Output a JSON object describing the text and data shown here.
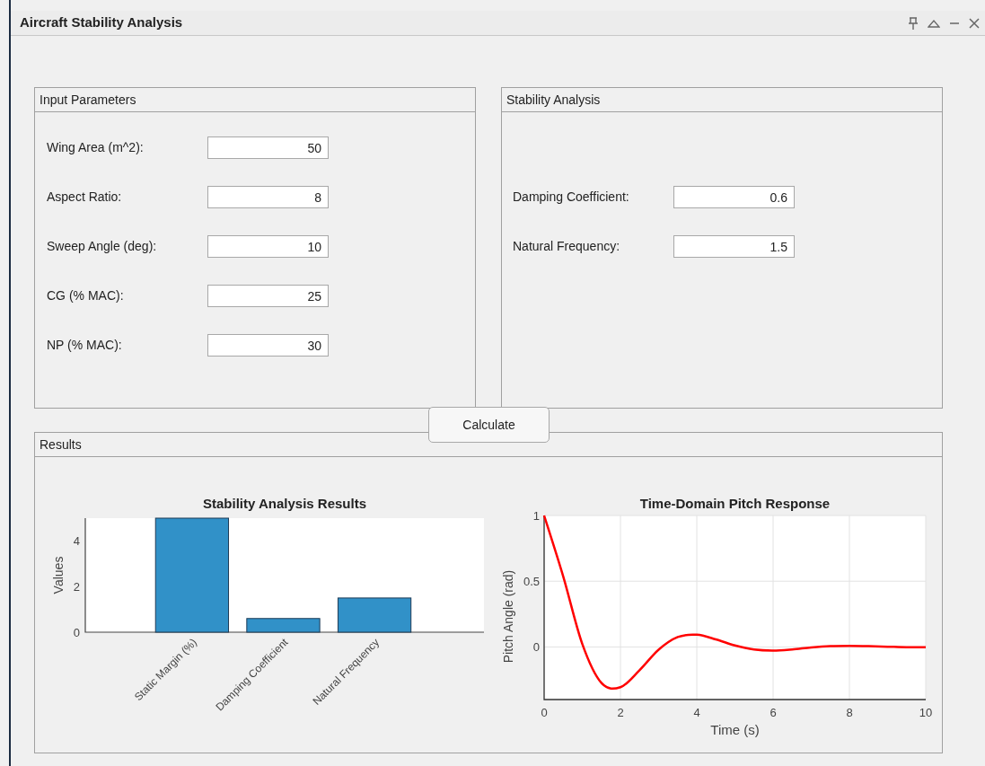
{
  "window": {
    "title": "Aircraft Stability Analysis"
  },
  "input_panel": {
    "title": "Input Parameters",
    "fields": [
      {
        "label": "Wing Area (m^2):",
        "value": "50"
      },
      {
        "label": "Aspect Ratio:",
        "value": "8"
      },
      {
        "label": "Sweep Angle (deg):",
        "value": "10"
      },
      {
        "label": "CG (% MAC):",
        "value": "25"
      },
      {
        "label": "NP (% MAC):",
        "value": "30"
      }
    ]
  },
  "stability_panel": {
    "title": "Stability Analysis",
    "fields": [
      {
        "label": "Damping Coefficient:",
        "value": "0.6"
      },
      {
        "label": "Natural Frequency:",
        "value": "1.5"
      }
    ]
  },
  "calculate_button": {
    "label": "Calculate"
  },
  "results_panel": {
    "title": "Results",
    "charts": [
      {
        "chart_data": {
          "type": "bar",
          "title": "Stability Analysis Results",
          "ylabel": "Values",
          "categories": [
            "Static Margin (%)",
            "Damping Coefficient",
            "Natural Frequency"
          ],
          "series": [
            {
              "color": "#3191c8",
              "values": [
                5,
                0.6,
                1.5
              ]
            }
          ],
          "ylim": [
            0,
            5
          ],
          "yticks": [
            0,
            2,
            4
          ]
        }
      },
      {
        "chart_data": {
          "type": "line",
          "title": "Time-Domain Pitch Response",
          "xlabel": "Time (s)",
          "ylabel": "Pitch Angle (rad)",
          "x": [
            0,
            0.5,
            1,
            1.5,
            2,
            2.5,
            3,
            3.5,
            4,
            4.5,
            5,
            5.5,
            6,
            6.5,
            7,
            7.5,
            8,
            8.5,
            9,
            9.5,
            10
          ],
          "series": [
            {
              "color": "#ff0000",
              "values": [
                1,
                0.537,
                0.023,
                -0.273,
                -0.306,
                -0.177,
                -0.021,
                0.075,
                0.093,
                0.058,
                0.011,
                -0.02,
                -0.028,
                -0.019,
                -0.004,
                0.006,
                0.008,
                0.006,
                0.002,
                -0.002,
                -0.003
              ]
            }
          ],
          "grid": true,
          "xlim": [
            0,
            10
          ],
          "ylim": [
            -0.4,
            1
          ],
          "xticks": [
            0,
            2,
            4,
            6,
            8,
            10
          ],
          "yticks": [
            0,
            0.5,
            1
          ]
        }
      }
    ]
  }
}
